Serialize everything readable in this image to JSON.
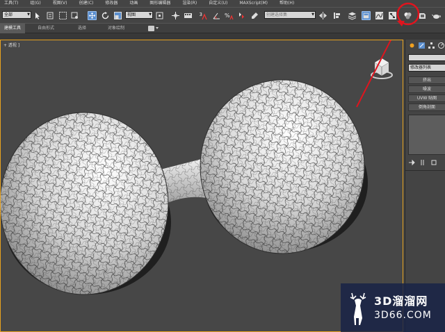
{
  "menu": {
    "items": [
      "工具(T)",
      "组(G)",
      "视图(V)",
      "创建(C)",
      "修改器",
      "动画",
      "图形编辑器",
      "渲染(R)",
      "自定义(U)",
      "MAXScript(M)",
      "帮助(H)"
    ]
  },
  "toolbar": {
    "selection_filter": "全部",
    "reference_coord": "视图",
    "named_selection_placeholder": "创建选择集"
  },
  "ribbon": {
    "tabs": [
      "建模工具",
      "自由形式",
      "选择",
      "对象绘制"
    ]
  },
  "viewport": {
    "label": "+ 透视 ]"
  },
  "command_panel": {
    "modifier_list": "修改器列表",
    "buttons": [
      "挤出",
      "噪波",
      "UVW 贴图",
      "倒角剖面"
    ]
  },
  "watermark": {
    "title": "3D溜溜网",
    "site": "3D66.COM"
  },
  "colors": {
    "viewport_bg": "#474747",
    "ui_bg": "#444444",
    "active_border": "#e8a21e",
    "highlight": "#e0141e",
    "active_button": "#5b8fcf"
  }
}
